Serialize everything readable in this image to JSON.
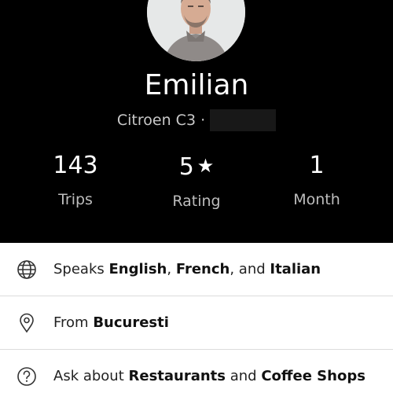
{
  "driver": {
    "name": "Emilian",
    "vehicle": "Citroen C3 ·"
  },
  "stats": [
    {
      "value": "143",
      "label": "Trips"
    },
    {
      "value": "5",
      "label": "Rating"
    },
    {
      "value": "1",
      "label": "Month"
    }
  ],
  "star_glyph": "★",
  "info": {
    "languages": {
      "prefix": "Speaks ",
      "items": [
        "English",
        "French",
        "Italian"
      ],
      "sep1": ", ",
      "sep2": ", and "
    },
    "hometown": {
      "prefix": "From ",
      "city": "Bucuresti"
    },
    "topics": {
      "prefix": "Ask about ",
      "items": [
        "Restaurants",
        "Coffee Shops"
      ],
      "sep": " and "
    }
  },
  "icons": {
    "languages": "globe-icon",
    "hometown": "location-pin-icon",
    "topics": "question-icon"
  },
  "colors": {
    "header_bg": "#000000",
    "text_primary": "#ffffff",
    "text_secondary": "#bdbdbd",
    "divider": "#dcdcdc"
  }
}
